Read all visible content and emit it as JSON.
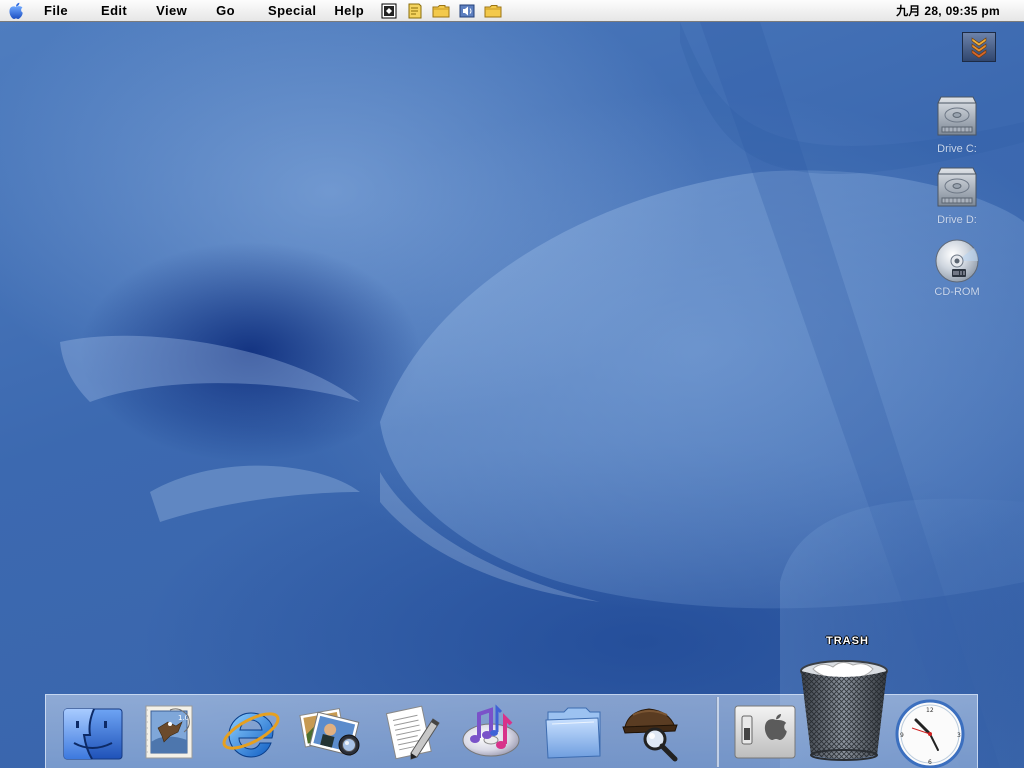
{
  "menubar": {
    "apple_icon": "apple-logo-icon",
    "menus": [
      "File",
      "Edit",
      "View",
      "Go",
      "Special",
      "Help"
    ],
    "app_icons": [
      "application-switcher-icon",
      "note-icon",
      "folder-icon",
      "sound-icon",
      "folder-icon"
    ],
    "clock": "九月 28,  09:35 pm"
  },
  "collapse_button": {
    "icon": "triple-chevron-down-icon"
  },
  "desktop": {
    "icons": [
      {
        "label": "Drive C:",
        "icon": "hard-drive-icon"
      },
      {
        "label": "Drive D:",
        "icon": "hard-drive-icon"
      },
      {
        "label": "CD-ROM",
        "icon": "cd-disc-icon"
      }
    ]
  },
  "dock": {
    "items": [
      {
        "name": "finder",
        "icon": "finder-icon"
      },
      {
        "name": "mail",
        "icon": "mail-stamp-icon"
      },
      {
        "name": "internet-explorer",
        "icon": "internet-explorer-icon"
      },
      {
        "name": "image-viewer",
        "icon": "photos-loupe-icon"
      },
      {
        "name": "text-editor",
        "icon": "document-pen-icon"
      },
      {
        "name": "itunes",
        "icon": "music-cd-icon"
      },
      {
        "name": "documents-folder",
        "icon": "folder-icon"
      },
      {
        "name": "sherlock",
        "icon": "sherlock-hat-icon"
      },
      {
        "name": "system-preferences",
        "icon": "apple-switch-icon"
      },
      {
        "name": "trash",
        "icon": "trash-can-icon"
      },
      {
        "name": "clock",
        "icon": "clock-icon"
      }
    ],
    "trash_label": "TRASH"
  },
  "colors": {
    "desktop": "#3f6eb3",
    "menubar": "#eeeeee"
  }
}
